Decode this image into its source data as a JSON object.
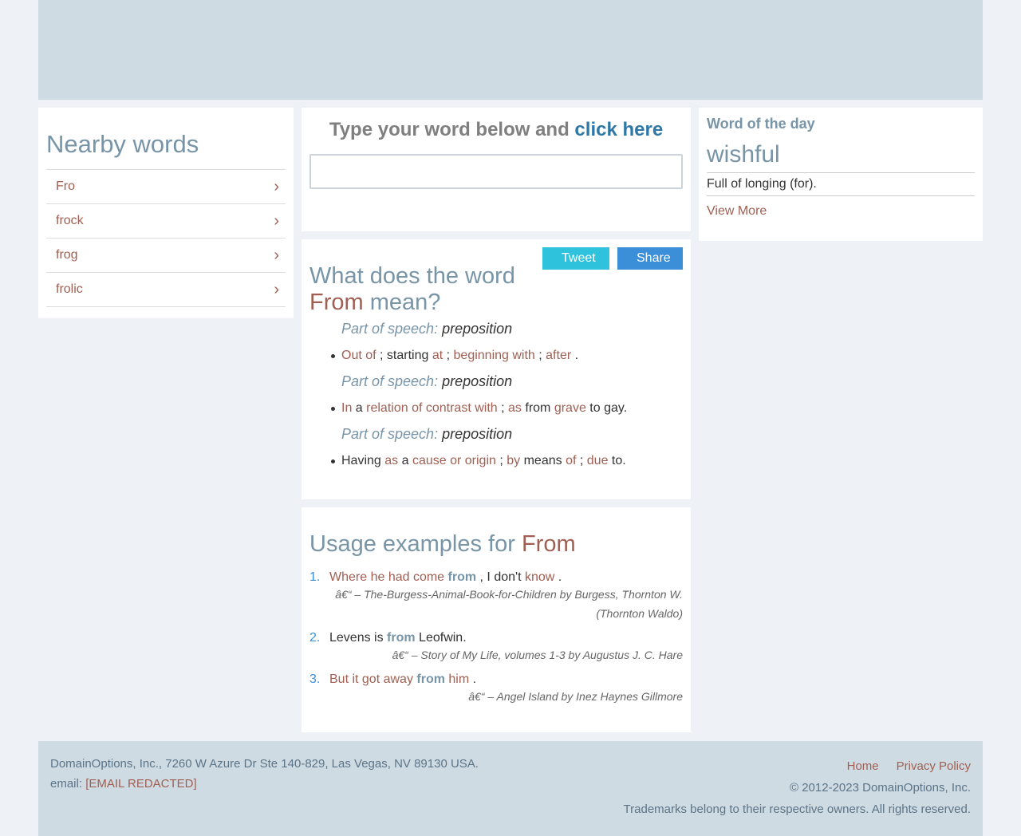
{
  "nearby": {
    "title": "Nearby words",
    "items": [
      {
        "label": "Fro"
      },
      {
        "label": "frock"
      },
      {
        "label": "frog"
      },
      {
        "label": "frolic"
      }
    ],
    "chevron": "›"
  },
  "search": {
    "prompt": "Type your word below and ",
    "link": "click here",
    "placeholder": ""
  },
  "share": {
    "tweet": "Tweet",
    "share": "Share",
    "tweet_icon": "",
    "share_icon": ""
  },
  "definition": {
    "heading_prefix": "What does the word ",
    "word": "From",
    "heading_suffix": " mean?",
    "pos_label": "Part of speech:",
    "pos_value": "preposition",
    "senses": [
      [
        {
          "t": "Out of",
          "c": "r"
        },
        {
          "t": " ; starting ",
          "c": ""
        },
        {
          "t": "at",
          "c": "r"
        },
        {
          "t": " ; ",
          "c": ""
        },
        {
          "t": "beginning with",
          "c": "r"
        },
        {
          "t": " ; ",
          "c": ""
        },
        {
          "t": "after",
          "c": "r"
        },
        {
          "t": " .",
          "c": ""
        }
      ],
      [
        {
          "t": "In",
          "c": "r"
        },
        {
          "t": " a ",
          "c": ""
        },
        {
          "t": "relation of contrast with",
          "c": "r"
        },
        {
          "t": " ; ",
          "c": ""
        },
        {
          "t": "as",
          "c": "r"
        },
        {
          "t": " from ",
          "c": ""
        },
        {
          "t": "grave",
          "c": "r"
        },
        {
          "t": " to gay.",
          "c": ""
        }
      ],
      [
        {
          "t": "Having ",
          "c": ""
        },
        {
          "t": "as",
          "c": "r"
        },
        {
          "t": " a ",
          "c": ""
        },
        {
          "t": "cause or origin",
          "c": "r"
        },
        {
          "t": " ; ",
          "c": ""
        },
        {
          "t": "by",
          "c": "r"
        },
        {
          "t": " means ",
          "c": ""
        },
        {
          "t": "of",
          "c": "r"
        },
        {
          "t": " ; ",
          "c": ""
        },
        {
          "t": "due",
          "c": "r"
        },
        {
          "t": " to.",
          "c": ""
        }
      ]
    ]
  },
  "usage": {
    "heading_prefix": "Usage examples for ",
    "word": "From",
    "examples": [
      {
        "num": "1.",
        "parts": [
          {
            "t": "Where he had come ",
            "c": "r"
          },
          {
            "t": "from",
            "c": "bold"
          },
          {
            "t": " , I don't ",
            "c": ""
          },
          {
            "t": "know",
            "c": "r"
          },
          {
            "t": " .",
            "c": ""
          }
        ],
        "source": "â€“ – The-Burgess-Animal-Book-for-Children by Burgess, Thornton W. (Thornton Waldo)"
      },
      {
        "num": "2.",
        "parts": [
          {
            "t": "Levens is ",
            "c": ""
          },
          {
            "t": "from",
            "c": "bold"
          },
          {
            "t": " Leofwin.",
            "c": ""
          }
        ],
        "source": "â€“ – Story of My Life, volumes 1-3 by Augustus J. C. Hare"
      },
      {
        "num": "3.",
        "parts": [
          {
            "t": "But it got away ",
            "c": "r"
          },
          {
            "t": "from",
            "c": "bold"
          },
          {
            "t": " him",
            "c": "r"
          },
          {
            "t": " .",
            "c": ""
          }
        ],
        "source": "â€“ – Angel Island by Inez Haynes Gillmore"
      }
    ]
  },
  "wotd": {
    "title": "Word of the day",
    "word": "wishful",
    "definition": "Full of longing (for).",
    "more": "View More"
  },
  "footer": {
    "address": "DomainOptions, Inc., 7260 W Azure Dr Ste 140-829, Las Vegas, NV 89130 USA.",
    "email_label": "email: ",
    "email": "[EMAIL REDACTED]",
    "links": [
      {
        "label": "Home"
      },
      {
        "label": "Privacy Policy"
      }
    ],
    "copyright": "© 2012-2023 DomainOptions, Inc.",
    "trademarks": "Trademarks belong to their respective owners. All rights reserved.",
    "social_icons": [
      "",
      ""
    ]
  },
  "colors": {
    "accent_blue": "#7895a8",
    "link_red": "#a05f52",
    "tweet": "#2fc2dc",
    "share": "#3b8fd8"
  }
}
